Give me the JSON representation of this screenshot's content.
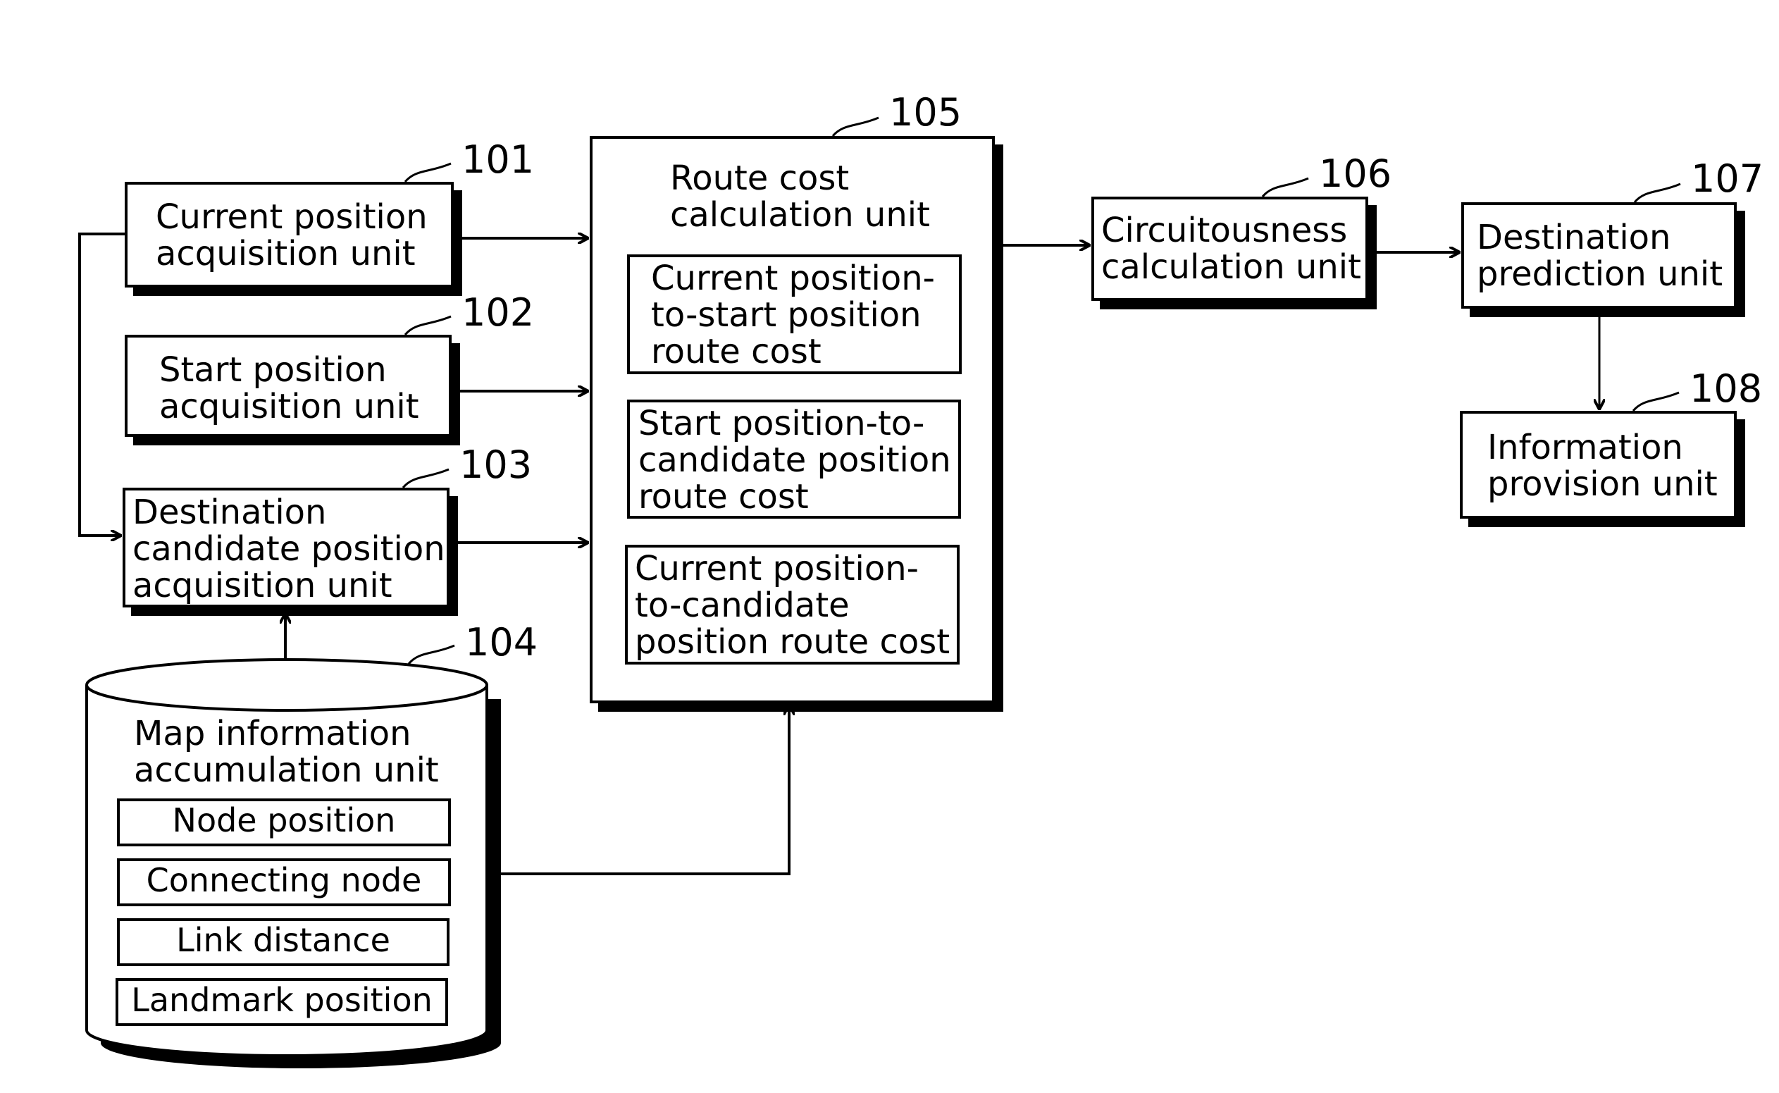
{
  "units": {
    "u101": {
      "ref": "101",
      "label": "Current position\nacquisition unit"
    },
    "u102": {
      "ref": "102",
      "label": "Start position\nacquisition unit"
    },
    "u103": {
      "ref": "103",
      "label": "Destination\ncandidate position\nacquisition unit"
    },
    "u104": {
      "ref": "104",
      "label": "Map information\naccumulation unit",
      "fields": [
        "Node position",
        "Connecting node",
        "Link distance",
        "Landmark position"
      ]
    },
    "u105": {
      "ref": "105",
      "label": "Route cost\ncalculation unit",
      "subunits": [
        "Current position-\nto-start position\nroute cost",
        "Start position-to-\ncandidate position\nroute cost",
        "Current position-\nto-candidate\nposition route cost"
      ]
    },
    "u106": {
      "ref": "106",
      "label": "Circuitousness\ncalculation unit"
    },
    "u107": {
      "ref": "107",
      "label": "Destination\nprediction unit"
    },
    "u108": {
      "ref": "108",
      "label": "Information\nprovision unit"
    }
  }
}
